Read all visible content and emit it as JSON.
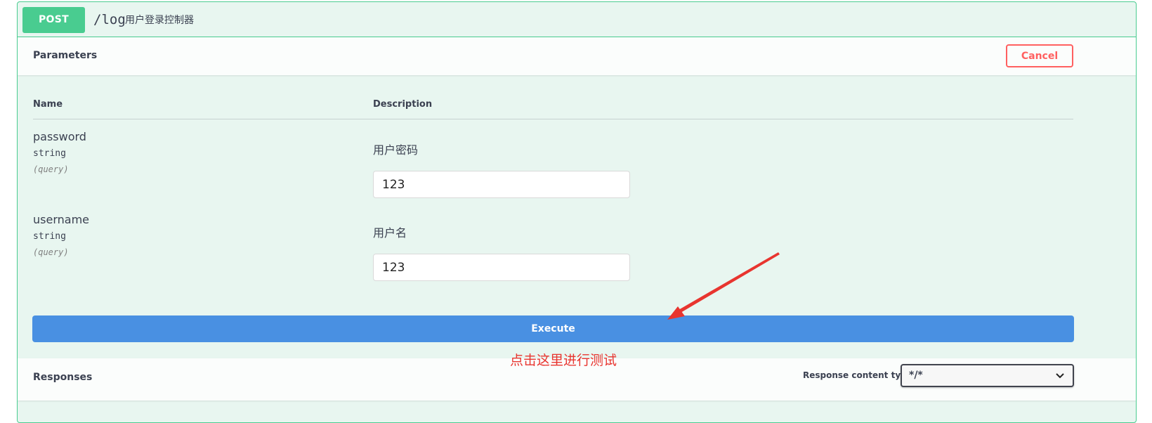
{
  "operation": {
    "method": "POST",
    "path": "/log",
    "summary": "用户登录控制器"
  },
  "parameters": {
    "title": "Parameters",
    "cancel_label": "Cancel",
    "col_name": "Name",
    "col_description": "Description",
    "items": [
      {
        "name": "password",
        "type": "string",
        "in": "(query)",
        "description": "用户密码",
        "value": "123"
      },
      {
        "name": "username",
        "type": "string",
        "in": "(query)",
        "description": "用户名",
        "value": "123"
      }
    ]
  },
  "execute_label": "Execute",
  "annotation": {
    "text": "点击这里进行测试",
    "color": "#e8352f"
  },
  "responses": {
    "title": "Responses",
    "content_type_label": "Response content type",
    "content_type_value": "*/*"
  },
  "colors": {
    "post": "#49cc90",
    "post_bg": "#e8f6f0",
    "execute": "#4990e2",
    "cancel": "#ff6060"
  }
}
